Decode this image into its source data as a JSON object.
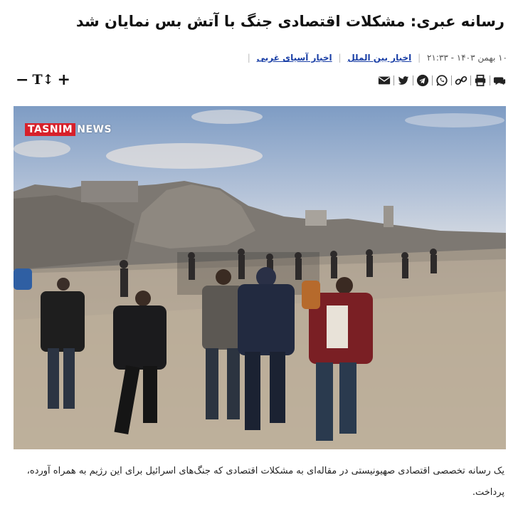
{
  "article": {
    "title": "رسانه عبری: مشکلات اقتصادی جنگ با آتش بس نمایان شد",
    "date": "۱۰ بهمن ۱۴۰۳ - ۲۱:۳۳",
    "categories": [
      "اخبار بین الملل",
      "اخبار آسیای غربی"
    ],
    "summary": "یک رسانه تخصصی اقتصادی صهیونیستی در مقاله‌ای به مشکلات اقتصادی که جنگ‌های اسرائیل برای این رژیم به همراه آورده، پرداخت."
  },
  "share_icons": [
    "comment-icon",
    "print-icon",
    "link-icon",
    "whatsapp-icon",
    "telegram-icon",
    "twitter-icon",
    "email-icon"
  ],
  "font_controls": {
    "decrease": "−",
    "label": "T↕",
    "increase": "+"
  },
  "photo": {
    "logo_brand": "TASNIM",
    "logo_suffix": "NEWS",
    "brand_color": "#d7202a"
  }
}
